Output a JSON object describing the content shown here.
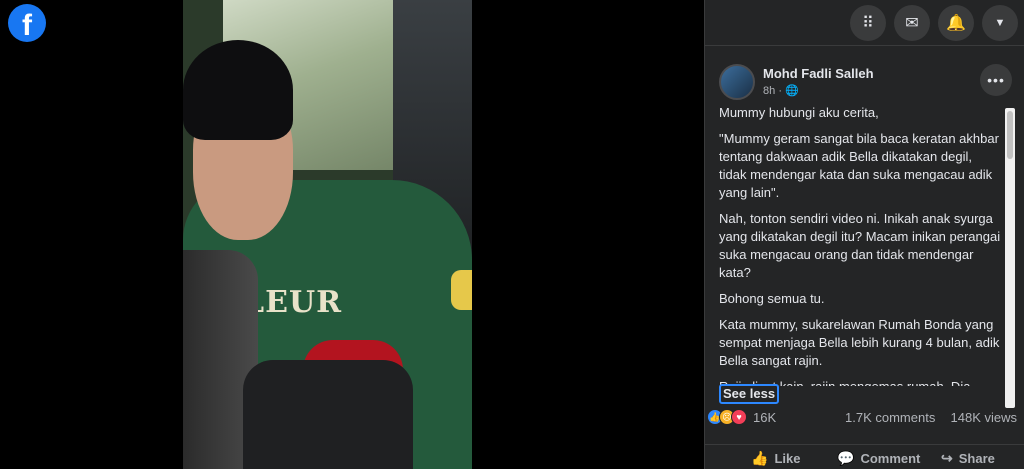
{
  "brand": {
    "logo_letter": "f",
    "color": "#1877f2"
  },
  "topbar": {
    "buttons": [
      {
        "icon": "menu-grid-icon",
        "glyph": "⠿"
      },
      {
        "icon": "messenger-icon",
        "glyph": "✉"
      },
      {
        "icon": "notifications-bell-icon",
        "glyph": "🔔"
      },
      {
        "icon": "account-chevron-icon",
        "glyph": "▼"
      }
    ]
  },
  "video": {
    "sweater_text": "LEUR"
  },
  "post": {
    "author": "Mohd Fadli Salleh",
    "time": "8h",
    "privacy_icon": "globe-icon",
    "paragraphs": [
      "Mummy hubungi aku cerita,",
      "\"Mummy geram sangat bila baca keratan akhbar tentang dakwaan adik Bella dikatakan degil, tidak mendengar kata dan suka mengacau adik yang lain\".",
      "Nah, tonton sendiri video ni. Inikah anak syurga yang dikatakan degil itu? Macam inikan perangai suka mengacau orang dan tidak mendengar kata?",
      "Bohong semua tu.",
      "Kata mummy, sukarelawan Rumah Bonda yang sempat menjaga Bella lebih kurang 4 bulan, adik Bella sangat rajin.",
      "Rajin lipat kain, rajin mengemas rumah. Dia"
    ],
    "see_less": "See less",
    "reaction_count": "16K",
    "comments": "1.7K comments",
    "views": "148K views"
  },
  "actions": {
    "like": "Like",
    "comment": "Comment",
    "share": "Share"
  }
}
